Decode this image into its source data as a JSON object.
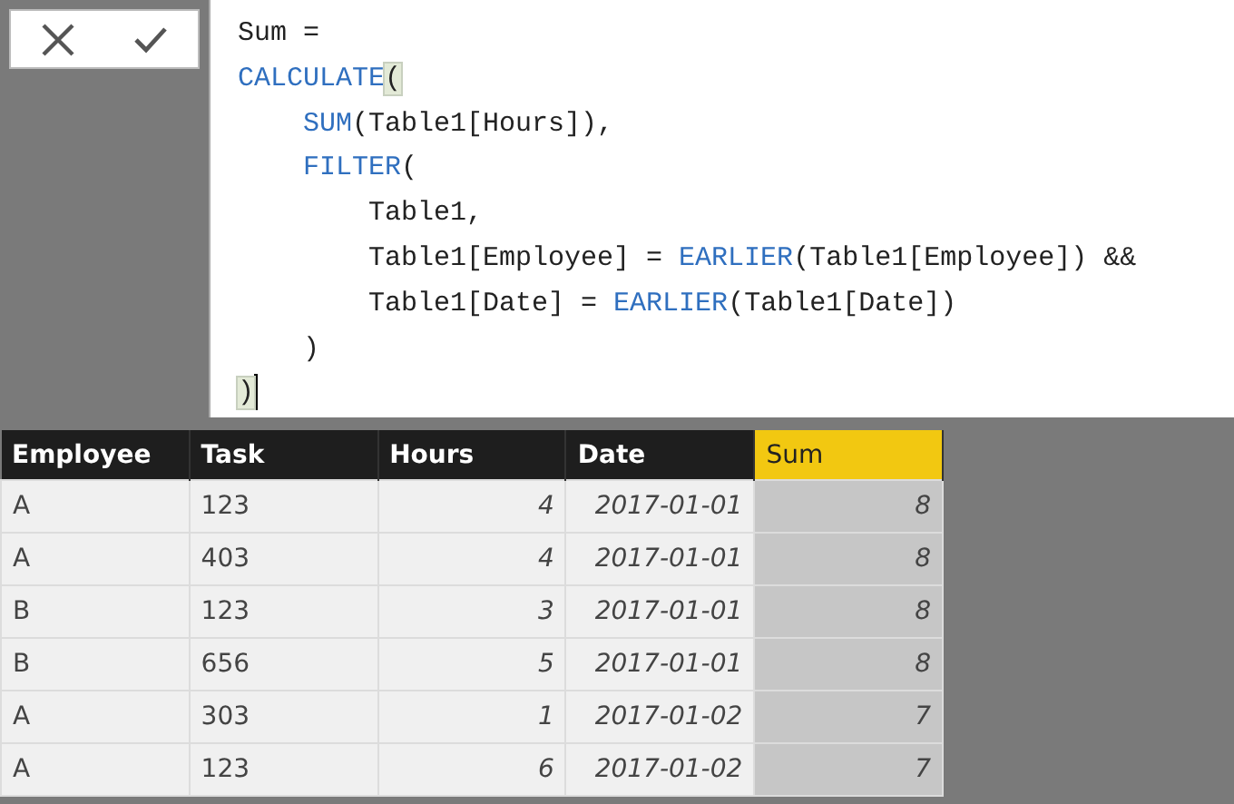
{
  "formula_bar": {
    "buttons": [
      {
        "kind": "cancel"
      },
      {
        "kind": "commit"
      }
    ],
    "lines": [
      [
        {
          "kind": "plain",
          "text": "Sum ="
        }
      ],
      [
        {
          "kind": "keyword",
          "text": "CALCULATE"
        },
        {
          "kind": "bracket",
          "text": "("
        }
      ],
      [
        {
          "kind": "keyword",
          "text": "    SUM"
        },
        {
          "kind": "plain",
          "text": "(Table1[Hours]),"
        }
      ],
      [
        {
          "kind": "keyword",
          "text": "    FILTER"
        },
        {
          "kind": "plain",
          "text": "("
        }
      ],
      [
        {
          "kind": "plain",
          "text": "        Table1,"
        }
      ],
      [
        {
          "kind": "plain",
          "text": "        Table1[Employee] = "
        },
        {
          "kind": "keyword",
          "text": "EARLIER"
        },
        {
          "kind": "plain",
          "text": "(Table1[Employee]) &&"
        }
      ],
      [
        {
          "kind": "plain",
          "text": "        Table1[Date] = "
        },
        {
          "kind": "keyword",
          "text": "EARLIER"
        },
        {
          "kind": "plain",
          "text": "(Table1[Date])"
        }
      ],
      [
        {
          "kind": "plain",
          "text": "    )"
        }
      ],
      [
        {
          "kind": "bracket",
          "text": ")"
        },
        {
          "kind": "cursor"
        }
      ]
    ]
  },
  "table": {
    "columns": [
      {
        "label": "Employee",
        "kind": "text",
        "selected": false
      },
      {
        "label": "Task",
        "kind": "text",
        "selected": false
      },
      {
        "label": "Hours",
        "kind": "number",
        "selected": false
      },
      {
        "label": "Date",
        "kind": "date",
        "selected": false
      },
      {
        "label": "Sum",
        "kind": "number",
        "selected": true
      }
    ],
    "rows": [
      [
        "A",
        "123",
        "4",
        "2017-01-01",
        "8"
      ],
      [
        "A",
        "403",
        "4",
        "2017-01-01",
        "8"
      ],
      [
        "B",
        "123",
        "3",
        "2017-01-01",
        "8"
      ],
      [
        "B",
        "656",
        "5",
        "2017-01-01",
        "8"
      ],
      [
        "A",
        "303",
        "1",
        "2017-01-02",
        "7"
      ],
      [
        "A",
        "123",
        "6",
        "2017-01-02",
        "7"
      ]
    ]
  }
}
